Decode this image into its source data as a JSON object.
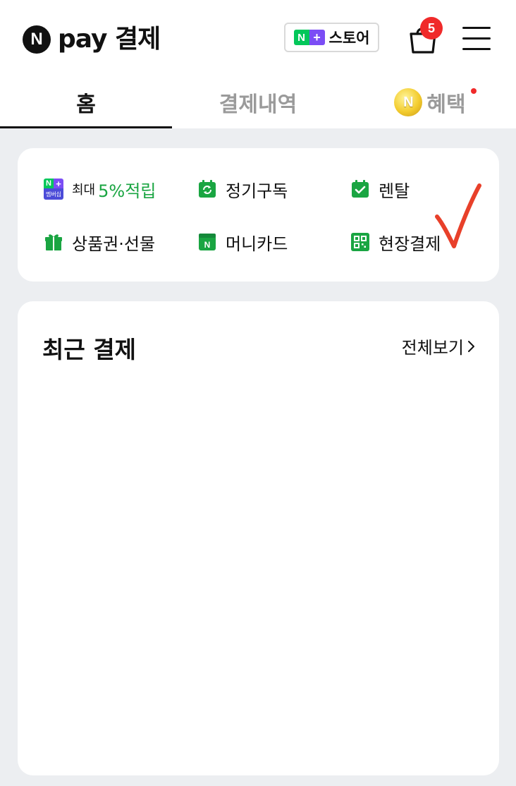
{
  "header": {
    "logo_letter": "N",
    "logo_text": "pay 결제",
    "store_badge_n": "N",
    "store_badge_plus": "+",
    "store_label": "스토어",
    "cart_count": "5",
    "icons": [
      "naver-logo-icon",
      "cart-icon",
      "hamburger-menu-icon"
    ]
  },
  "tabs": [
    {
      "label": "홈",
      "active": true
    },
    {
      "label": "결제내역",
      "active": false
    },
    {
      "label": "혜택",
      "active": false,
      "has_new_dot": true,
      "coin_letter": "N"
    }
  ],
  "quick_menu": {
    "membership_n": "N",
    "membership_plus": "+",
    "membership_caption": "멤버십",
    "membership_prefix": "최대",
    "membership_label": "5%적립",
    "subscription_label": "정기구독",
    "rental_label": "렌탈",
    "gift_label": "상품권·선물",
    "money_card_label": "머니카드",
    "money_card_icon_letter": "N",
    "onsite_payment_label": "현장결제"
  },
  "recent_payments": {
    "title": "최근 결제",
    "view_all_label": "전체보기"
  },
  "colors": {
    "naver_green": "#03c75a",
    "plus_purple": "#7b4df5",
    "badge_red": "#f02a2a",
    "accent_green_text": "#1aa542",
    "background": "#eceef1"
  }
}
